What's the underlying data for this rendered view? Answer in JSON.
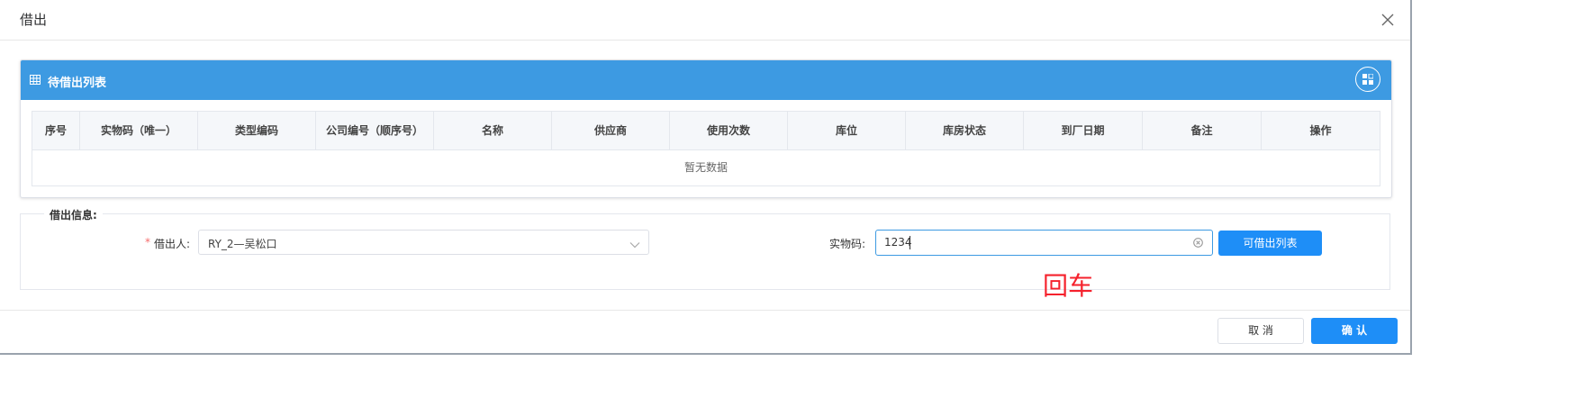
{
  "dialog": {
    "title": "借出",
    "close_icon": "close-icon"
  },
  "panel": {
    "title": "待借出列表",
    "title_icon": "table-icon",
    "tool_icon": "grid-layout-icon",
    "header_color": "#3d9ae2"
  },
  "table": {
    "columns": [
      "序号",
      "实物码（唯一）",
      "类型编码",
      "公司编号（顺序号）",
      "名称",
      "供应商",
      "使用次数",
      "库位",
      "库房状态",
      "到厂日期",
      "备注",
      "操作"
    ],
    "empty_text": "暂无数据"
  },
  "form": {
    "legend": "借出信息:",
    "required_mark": "*",
    "borrower_label": "借出人:",
    "borrower_value": "RY_2—吴松口",
    "borrower_arrow_icon": "chevron-down-icon",
    "code_label": "实物码:",
    "code_value": "1234",
    "clear_icon": "clear-circle-icon",
    "list_button": "可借出列表"
  },
  "annotation": {
    "text": "回车",
    "color": "#f5222d"
  },
  "footer": {
    "cancel_label": "取 消",
    "confirm_label": "确 认",
    "primary_color": "#1e8ef7"
  }
}
